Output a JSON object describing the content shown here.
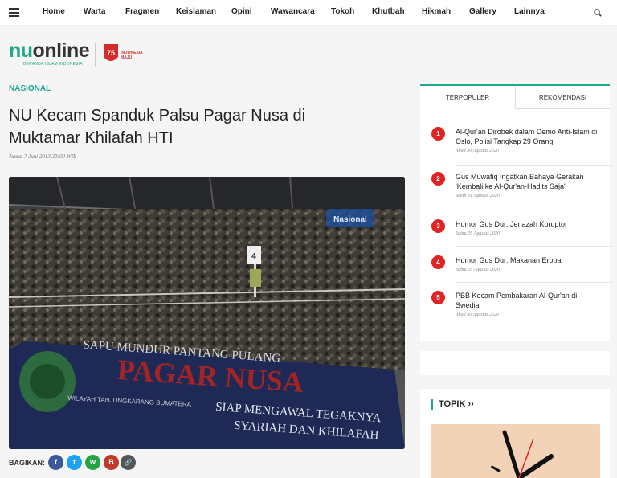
{
  "nav": {
    "items": [
      "Home",
      "Warta",
      "Fragmen",
      "Keislaman",
      "Opini",
      "Wawancara",
      "Tokoh",
      "Khutbah",
      "Hikmah",
      "Gallery",
      "Lainnya"
    ]
  },
  "logo": {
    "nu": "nu",
    "online": "online",
    "tagline": "BERANDA ISLAM INDONESIA",
    "badge_line1": "INDONESIA",
    "badge_line2": "MAJU",
    "badge_number": "75"
  },
  "article": {
    "category": "NASIONAL",
    "title": "NU Kecam Spanduk Palsu Pagar Nusa di Muktamar Khilafah HTI",
    "date": "Jumat 7 Juni 2013 22:00 WIB",
    "photo": {
      "watermark": "Nasional",
      "counter": "4",
      "banner_top": "SAPU MUNDUR PANTANG PULANG",
      "banner_main": "PAGAR NUSA",
      "banner_sub": "WILAYAH TANJUNGKARANG SUMATERA",
      "banner_right_1": "SIAP MENGAWAL TEGAKNYA",
      "banner_right_2": "SYARIAH DAN KHILAFAH"
    },
    "share_label": "BAGIKAN:",
    "share_buttons": [
      {
        "icon": "facebook-icon",
        "glyph": "f",
        "color": "#3b5998"
      },
      {
        "icon": "twitter-icon",
        "glyph": "t",
        "color": "#1da1f2"
      },
      {
        "icon": "whatsapp-icon",
        "glyph": "w",
        "color": "#25a244"
      },
      {
        "icon": "copy-icon",
        "glyph": "B",
        "color": "#c0392b"
      },
      {
        "icon": "link-icon",
        "glyph": "🔗",
        "color": "#555555"
      }
    ]
  },
  "sidebar": {
    "tabs": [
      "TERPOPULER",
      "REKOMENDASI"
    ],
    "popular": [
      {
        "num": "1",
        "title": "Al-Qur'an Dirobek dalam Demo Anti-Islam di Oslo, Polisi Tangkap 29 Orang",
        "date": "Ahad 30 Agustus 2020"
      },
      {
        "num": "2",
        "title": "Gus Muwafiq Ingatkan Bahaya Gerakan 'Kembali ke Al-Qur'an-Hadits Saja'",
        "date": "Senin 31 Agustus 2020"
      },
      {
        "num": "3",
        "title": "Humor Gus Dur: Jenazah Koruptor",
        "date": "Sabtu 29 Agustus 2020"
      },
      {
        "num": "4",
        "title": "Humor Gus Dur: Makanan Eropa",
        "date": "Sabtu 29 Agustus 2020"
      },
      {
        "num": "5",
        "title": "PBB Kecam Pembakaran Al-Qur'an di Swedia",
        "date": "Ahad 30 Agustus 2020"
      }
    ],
    "topik_label": "TOPIK ››"
  },
  "colors": {
    "accent": "#1fa88b",
    "badge_red": "#e02424"
  }
}
